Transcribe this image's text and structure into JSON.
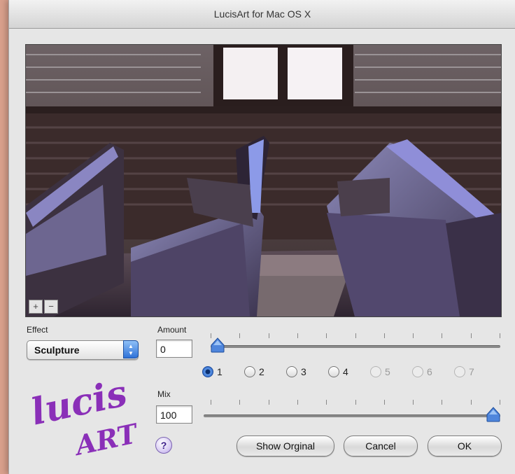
{
  "window": {
    "title": "LucisArt for Mac OS X"
  },
  "preview": {
    "zoom_in": "+",
    "zoom_out": "−"
  },
  "effect": {
    "label": "Effect",
    "selected": "Sculpture"
  },
  "amount": {
    "label": "Amount",
    "value": "0",
    "slider_level": 0
  },
  "levels": {
    "options": [
      "1",
      "2",
      "3",
      "4",
      "5",
      "6",
      "7"
    ],
    "selected": "1"
  },
  "mix": {
    "label": "Mix",
    "value": "100",
    "slider_level": 100
  },
  "buttons": {
    "help": "?",
    "show_original": "Show Orginal",
    "cancel": "Cancel",
    "ok": "OK"
  },
  "logo": {
    "line1": "lucis",
    "line2": "ART"
  },
  "colors": {
    "accent": "#2f72d8",
    "logo": "#8a2fb8",
    "thumb": "#4f86dc"
  }
}
